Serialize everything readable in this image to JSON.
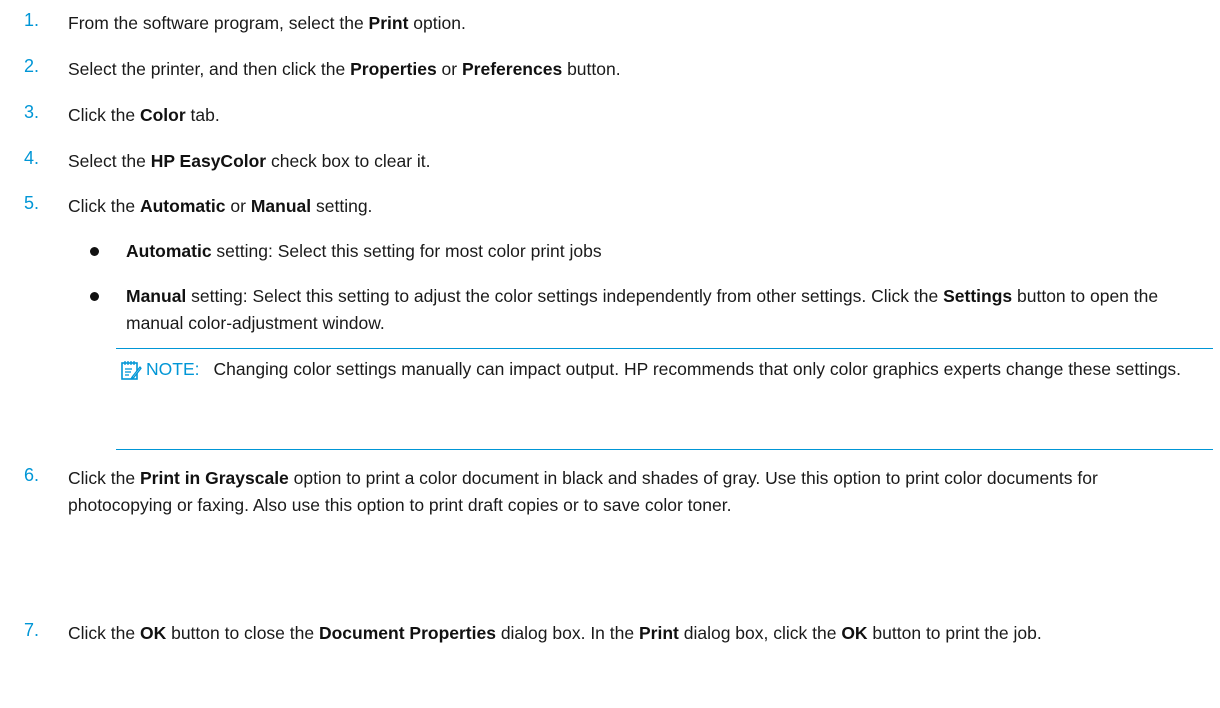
{
  "steps": [
    {
      "num": "1.",
      "a": "From the software program, select the ",
      "b1": "Print",
      "c": " option."
    },
    {
      "num": "2.",
      "a": "Select the printer, and then click the ",
      "b1": "Properties",
      "c": " or ",
      "b2": "Preferences",
      "d": " button."
    },
    {
      "num": "3.",
      "a": "Click the ",
      "b1": "Color",
      "c": " tab."
    },
    {
      "num": "4.",
      "a": "Select the ",
      "b1": "HP EasyColor",
      "c": " check box to clear it."
    },
    {
      "num": "5.",
      "a": "Click the ",
      "b1": "Automatic",
      "c": " or ",
      "b2": "Manual",
      "d": " setting."
    },
    {
      "num": "6.",
      "a": "Click the ",
      "b1": "Print in Grayscale",
      "c": " option to print a color document in black and shades of gray. Use this option to print color documents for photocopying or faxing. Also use this option to print draft copies or to save color toner."
    },
    {
      "num": "7.",
      "a": "Click the ",
      "b1": "OK",
      "c": " button to close the ",
      "b2": "Document Properties",
      "d": " dialog box. In the ",
      "b3": "Print",
      "e": " dialog box, click the ",
      "b4": "OK",
      "f": " button to print the job."
    }
  ],
  "bullets": [
    {
      "b1": "Automatic",
      "a": " setting: Select this setting for most color print jobs"
    },
    {
      "b1": "Manual",
      "a": " setting: Select this setting to adjust the color settings independently from other settings. Click the ",
      "b2": "Settings",
      "c": " button to open the manual color-adjustment window."
    }
  ],
  "note": {
    "icon": "note-pad-icon",
    "label": "NOTE:",
    "text": "Changing color settings manually can impact output. HP recommends that only color graphics experts change these settings."
  },
  "colors": {
    "accent": "#0096d6",
    "text": "#1a1a1a"
  }
}
